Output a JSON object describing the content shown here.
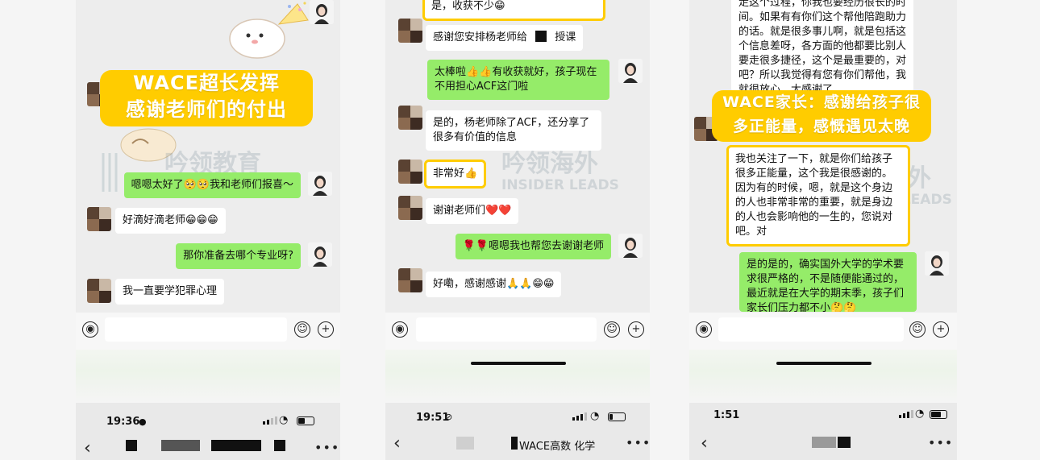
{
  "panel1": {
    "banner_line1": "WACE超长发挥",
    "banner_line2": "感谢老师们的付出",
    "watermark": "吟领教育",
    "messages": [
      {
        "side": "out",
        "text": "嗯嗯太好了🥺🥺我和老师们报喜～"
      },
      {
        "side": "in",
        "text": "好滴好滴老师😁😁😁"
      },
      {
        "side": "out",
        "text": "那你准备去哪个专业呀?"
      },
      {
        "side": "in",
        "text": "我一直要学犯罪心理"
      }
    ],
    "status": {
      "time": "19:36",
      "person_icon": "person-icon"
    }
  },
  "panel2": {
    "watermark_cn": "吟领海外",
    "watermark_en": "INSIDER LEADS",
    "messages": [
      {
        "side": "in",
        "text": "是，收获不少😁"
      },
      {
        "side": "in",
        "text": "感谢您安排杨老师给",
        "text2": "授课"
      },
      {
        "side": "out",
        "text": "太棒啦👍👍有收获就好，孩子现在不用担心ACF这门啦"
      },
      {
        "side": "in",
        "text": "是的，杨老师除了ACF，还分享了很多有价值的信息"
      },
      {
        "side": "in",
        "text": "非常好👍"
      },
      {
        "side": "in",
        "text": "谢谢老师们❤️❤️"
      },
      {
        "side": "out",
        "text": "🌹🌹嗯嗯我也帮您去谢谢老师"
      },
      {
        "side": "in",
        "text": "好嘞，感谢感谢🙏🙏😁😁"
      }
    ],
    "status": {
      "time": "19:51",
      "mute_icon": "bell-slash-icon",
      "title": "WACE高数 化学"
    }
  },
  "panel3": {
    "watermark_cn": "吟领海外",
    "watermark_en": "INSIDER LEADS",
    "banner_line1": "WACE家长：感谢给孩子很",
    "banner_line2": "多正能量，感慨遇见太晚",
    "messages": [
      {
        "side": "in",
        "text": "走这个过程，你我也要经历很长的时间。如果有有你们这个帮他陪跑助力的话。就是很多事儿啊，就是包括这个信息差呀，各方面的他都要比别人要走很多捷径，这个是最重要的，对吧？所以我觉得有您有你们帮他，我就很放心，太感谢了"
      },
      {
        "side": "in",
        "text": "我也关注了一下，就是你们给孩子很多正能量，这个我是很感谢的。因为有的时候，嗯，就是这个身边的人也非常非常的重要，就是身边的人也会影响他的一生的，您说对吧。对"
      },
      {
        "side": "out",
        "text": "是的是的，确实国外大学的学术要求很严格的，不是随便能通过的，最近就是在大学的期末季，孩子们家长们压力都不小🤔🤔"
      }
    ],
    "status": {
      "time": "1:51"
    }
  },
  "input_bar": {
    "voice_icon": "voice-icon",
    "emoji_icon": "emoji-icon",
    "plus_icon": "plus-icon"
  },
  "nav": {
    "back_icon": "back-icon",
    "more_icon": "more-icon"
  },
  "colors": {
    "outgoing_bubble": "#95ec69",
    "incoming_bubble": "#ffffff",
    "highlight": "#ffcc00",
    "chat_bg": "#ededed"
  }
}
